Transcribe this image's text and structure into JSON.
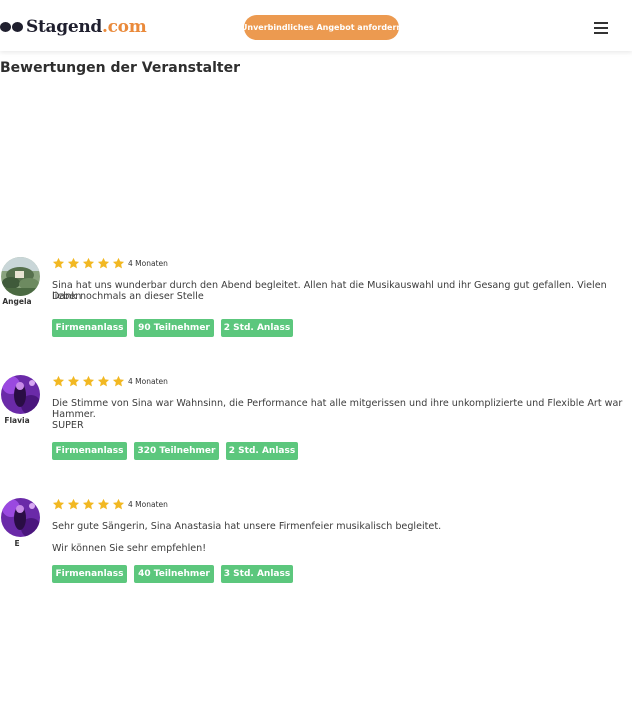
{
  "header": {
    "logo_name": "Stagend",
    "logo_tld": ".com",
    "cta_label": "Unverbindliches Angebot anfordern",
    "menu_icon": "hamburger-menu-icon"
  },
  "page_title": "Bewertungen der Veranstalter",
  "colors": {
    "accent": "#ec9a50",
    "tag": "#5cc77d",
    "star": "#f2b822"
  },
  "reviews": [
    {
      "name": "Angela",
      "rating": 5,
      "date": "4 Monaten",
      "text": [
        "Sina hat uns wunderbar durch den Abend begleitet. Allen hat die Musikauswahl und ihr Gesang gut gefallen. Vielen lieben",
        "Dank nochmals an dieser Stelle"
      ],
      "tags": [
        "Firmenanlass",
        "90 Teilnehmer",
        "2 Std. Anlass"
      ]
    },
    {
      "name": "Flavia",
      "rating": 5,
      "date": "4 Monaten",
      "text": [
        "Die Stimme von Sina war Wahnsinn, die Performance hat alle mitgerissen und ihre unkomplizierte und Flexible Art war",
        "Hammer.",
        "SUPER"
      ],
      "tags": [
        "Firmenanlass",
        "320 Teilnehmer",
        "2 Std. Anlass"
      ]
    },
    {
      "name": "E",
      "rating": 5,
      "date": "4 Monaten",
      "text": [
        "Sehr gute Sängerin, Sina Anastasia hat unsere Firmenfeier musikalisch begleitet.",
        "Wir können Sie sehr empfehlen!"
      ],
      "tags": [
        "Firmenanlass",
        "40 Teilnehmer",
        "3 Std. Anlass"
      ]
    }
  ]
}
